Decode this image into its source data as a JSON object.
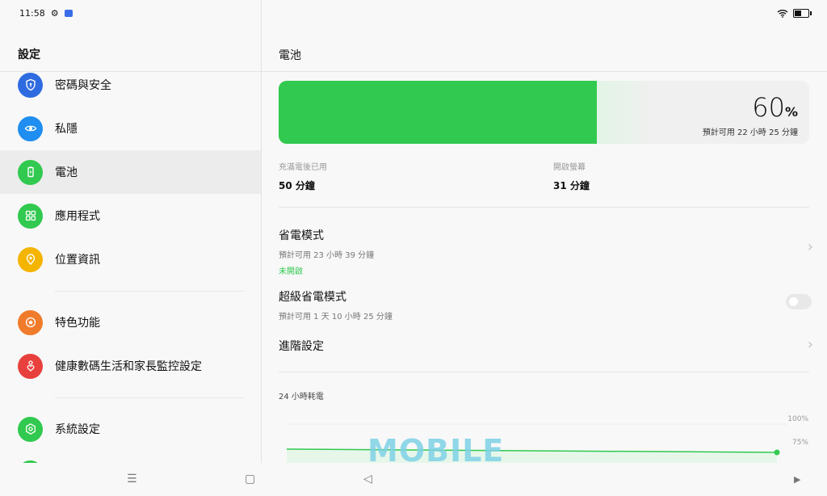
{
  "status_bar": {
    "time": "11:58"
  },
  "left_pane": {
    "title": "設定",
    "items": [
      {
        "label": "密碼與安全",
        "color": "#2f6be0",
        "icon": "shield-lock-icon"
      },
      {
        "label": "私隱",
        "color": "#1f8ef0",
        "icon": "eye-lock-icon"
      },
      {
        "label": "電池",
        "color": "#31c94f",
        "icon": "battery-icon",
        "active": true
      },
      {
        "label": "應用程式",
        "color": "#31c94f",
        "icon": "grid-icon"
      },
      {
        "label": "位置資訊",
        "color": "#f4b400",
        "icon": "location-icon"
      },
      {
        "label": "特色功能",
        "color": "#f07b2a",
        "icon": "star-icon"
      },
      {
        "label": "健康數碼生活和家長監控設定",
        "color": "#e8403c",
        "icon": "heart-person-icon"
      },
      {
        "label": "系統設定",
        "color": "#31c94f",
        "icon": "gear-icon"
      }
    ]
  },
  "right_pane": {
    "title": "電池",
    "battery": {
      "percent": "60",
      "percent_unit": "%",
      "level": 0.6,
      "estimate": "預計可用 22 小時 25 分鐘"
    },
    "stats": [
      {
        "label": "充滿電後已用",
        "value": "50 分鐘"
      },
      {
        "label": "開啟螢幕",
        "value": "31 分鐘"
      }
    ],
    "power_saving": {
      "title": "省電模式",
      "subtitle": "預計可用 23 小時 39 分鐘",
      "status": "未開啟"
    },
    "super_power_saving": {
      "title": "超級省電模式",
      "subtitle": "預計可用 1 天 10 小時 25 分鐘",
      "enabled": false
    },
    "advanced": {
      "title": "進階設定"
    },
    "chart_label": "24 小時耗電",
    "chart_ticks": [
      "100%",
      "75%"
    ]
  },
  "watermark": "MOBILE",
  "colors": {
    "accent": "#31c94f"
  }
}
